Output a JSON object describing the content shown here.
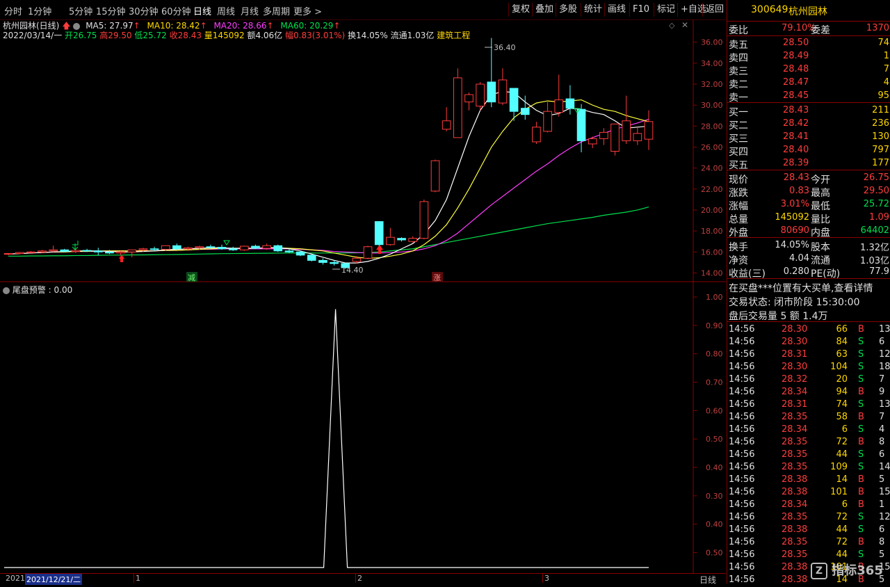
{
  "toolbar": {
    "periods": [
      "分时",
      "1分钟",
      "5分钟",
      "15分钟",
      "30分钟",
      "60分钟",
      "日线",
      "周线",
      "月线",
      "多周期",
      "更多 >"
    ],
    "active_period": "日线",
    "buttons": [
      "复权",
      "叠加",
      "多股",
      "统计",
      "画线",
      "F10",
      "标记",
      "+自选",
      "返回"
    ]
  },
  "chart_header": {
    "stock_title": "杭州园林(日线)",
    "ma5": "MA5: 27.97",
    "ma10": "MA10: 28.42",
    "ma20": "MA20: 28.66",
    "ma60": "MA60: 20.29",
    "date": "2022/03/14/一",
    "open": "开26.75",
    "high": "高29.50",
    "low": "低25.72",
    "close": "收28.43",
    "volume": "量145092",
    "amount": "额4.06亿",
    "change": "幅0.83(3.01%)",
    "turnover": "换14.05%",
    "float_cap": "流通1.03亿",
    "sector": "建筑工程"
  },
  "price_axis": [
    "36.00",
    "34.00",
    "32.00",
    "30.00",
    "28.00",
    "26.00",
    "24.00",
    "22.00",
    "20.00",
    "18.00",
    "16.00",
    "14.00"
  ],
  "annotations": {
    "high_label": "36.40",
    "low_label": "14.40",
    "sign_decrease": "减",
    "sign_increase": "涨"
  },
  "oscillator": {
    "title": "尾盘预警 : 0.00",
    "axis": [
      "1.00",
      "0.90",
      "0.80",
      "0.70",
      "0.60",
      "0.50",
      "0.40",
      "0.30",
      "0.40",
      "0.50"
    ]
  },
  "bottom_bar": {
    "year": "2021",
    "date": "2021/12/21/二",
    "marks": [
      "1",
      "2",
      "3"
    ],
    "period": "日线"
  },
  "colors": {
    "up": "#ff3c3c",
    "down": "#54ffff",
    "ma5": "#ffffff",
    "ma10": "#ffff3c",
    "ma20": "#ff3cff",
    "ma60": "#00e04e",
    "grid": "#8b0000"
  },
  "chart_data": {
    "type": "candlestick",
    "candles": [
      [
        15.8,
        15.9,
        15.7,
        15.85
      ],
      [
        15.85,
        16.0,
        15.8,
        15.95
      ],
      [
        15.95,
        16.1,
        15.9,
        16.0
      ],
      [
        16.0,
        16.2,
        15.9,
        16.1
      ],
      [
        16.1,
        16.6,
        16.0,
        16.2
      ],
      [
        16.2,
        16.3,
        16.0,
        16.05
      ],
      [
        16.05,
        16.3,
        15.9,
        16.15
      ],
      [
        16.15,
        16.3,
        16.0,
        16.1
      ],
      [
        16.1,
        16.4,
        15.7,
        16.0
      ],
      [
        16.0,
        16.2,
        15.8,
        15.9
      ],
      [
        15.9,
        16.1,
        15.7,
        16.0
      ],
      [
        16.0,
        16.2,
        15.5,
        16.2
      ],
      [
        16.2,
        16.4,
        16.0,
        16.3
      ],
      [
        16.3,
        16.5,
        16.1,
        16.25
      ],
      [
        16.25,
        16.6,
        16.1,
        16.6
      ],
      [
        16.6,
        16.8,
        16.2,
        16.3
      ],
      [
        16.3,
        16.5,
        16.1,
        16.4
      ],
      [
        16.4,
        16.6,
        16.2,
        16.5
      ],
      [
        16.5,
        16.7,
        16.3,
        16.45
      ],
      [
        16.45,
        16.7,
        16.2,
        16.3
      ],
      [
        16.3,
        16.5,
        16.1,
        16.2
      ],
      [
        16.2,
        16.6,
        16.1,
        16.55
      ],
      [
        16.55,
        16.7,
        16.3,
        16.35
      ],
      [
        16.35,
        16.8,
        16.2,
        16.6
      ],
      [
        16.6,
        16.7,
        16.0,
        16.1
      ],
      [
        16.1,
        16.3,
        15.9,
        16.0
      ],
      [
        16.0,
        16.1,
        15.6,
        15.7
      ],
      [
        15.7,
        15.8,
        15.1,
        15.2
      ],
      [
        15.2,
        15.4,
        14.8,
        15.0
      ],
      [
        15.0,
        15.2,
        14.7,
        14.9
      ],
      [
        14.9,
        15.0,
        14.4,
        14.5
      ],
      [
        15.1,
        15.6,
        14.9,
        15.4
      ],
      [
        15.4,
        16.6,
        15.3,
        16.5
      ],
      [
        18.9,
        18.9,
        16.5,
        16.7
      ],
      [
        16.7,
        18.3,
        16.6,
        17.4
      ],
      [
        17.3,
        17.4,
        17.0,
        17.15
      ],
      [
        17.0,
        17.5,
        16.9,
        17.3
      ],
      [
        17.3,
        21.0,
        17.2,
        20.8
      ],
      [
        21.8,
        24.8,
        21.7,
        24.7
      ],
      [
        27.7,
        29.8,
        27.5,
        28.5
      ],
      [
        26.9,
        33.5,
        26.9,
        32.6
      ],
      [
        30.3,
        31.2,
        29.5,
        31.0
      ],
      [
        29.9,
        32.2,
        29.5,
        32.0
      ],
      [
        32.2,
        36.4,
        29.8,
        30.3
      ],
      [
        30.2,
        33.5,
        30.0,
        32.4
      ],
      [
        31.6,
        31.6,
        28.5,
        29.4
      ],
      [
        29.7,
        30.9,
        28.6,
        29.1
      ],
      [
        26.5,
        28.4,
        26.3,
        27.9
      ],
      [
        27.5,
        30.3,
        27.4,
        29.4
      ],
      [
        29.3,
        32.9,
        28.9,
        30.5
      ],
      [
        30.6,
        31.9,
        29.1,
        29.7
      ],
      [
        29.6,
        30.1,
        25.5,
        26.6
      ],
      [
        26.3,
        27.0,
        25.9,
        26.8
      ],
      [
        26.8,
        27.8,
        26.2,
        27.4
      ],
      [
        25.6,
        27.9,
        25.2,
        28.2
      ],
      [
        26.6,
        30.9,
        26.3,
        28.5
      ],
      [
        26.6,
        28.0,
        26.2,
        27.3
      ],
      [
        26.75,
        29.5,
        25.72,
        28.43
      ]
    ],
    "ma5": [
      15.8,
      15.85,
      15.9,
      15.95,
      16.0,
      16.05,
      16.1,
      16.1,
      16.1,
      16.05,
      16.0,
      16.0,
      16.05,
      16.1,
      16.2,
      16.25,
      16.3,
      16.35,
      16.4,
      16.4,
      16.35,
      16.35,
      16.35,
      16.4,
      16.4,
      16.3,
      16.1,
      15.8,
      15.5,
      15.2,
      14.95,
      14.95,
      15.1,
      15.4,
      15.8,
      16.3,
      16.8,
      17.7,
      19.0,
      21.0,
      24.0,
      27.0,
      29.5,
      31.0,
      31.3,
      31.2,
      30.3,
      29.5,
      29.0,
      29.2,
      29.7,
      29.6,
      29.3,
      29.1,
      28.5,
      27.8,
      27.9,
      28.0
    ],
    "ma10": [
      15.8,
      15.85,
      15.9,
      15.95,
      16.0,
      16.0,
      16.05,
      16.05,
      16.1,
      16.1,
      16.1,
      16.1,
      16.1,
      16.1,
      16.15,
      16.15,
      16.2,
      16.25,
      16.3,
      16.35,
      16.35,
      16.35,
      16.35,
      16.4,
      16.4,
      16.35,
      16.3,
      16.2,
      16.1,
      15.9,
      15.7,
      15.5,
      15.4,
      15.45,
      15.6,
      15.8,
      16.1,
      16.7,
      17.5,
      18.6,
      20.2,
      22.0,
      24.0,
      26.0,
      27.5,
      28.8,
      29.6,
      30.2,
      30.4,
      30.3,
      30.4,
      30.5,
      30.0,
      29.6,
      29.4,
      29.0,
      28.7,
      28.42
    ],
    "ma20": [
      15.8,
      15.85,
      15.9,
      15.95,
      16.0,
      16.0,
      16.05,
      16.05,
      16.05,
      16.1,
      16.1,
      16.1,
      16.1,
      16.1,
      16.15,
      16.15,
      16.2,
      16.25,
      16.25,
      16.3,
      16.3,
      16.3,
      16.3,
      16.3,
      16.3,
      16.3,
      16.25,
      16.2,
      16.15,
      16.05,
      16.0,
      15.95,
      15.9,
      15.9,
      15.95,
      16.0,
      16.1,
      16.3,
      16.6,
      17.1,
      17.8,
      18.7,
      19.6,
      20.5,
      21.3,
      22.1,
      22.9,
      23.7,
      24.4,
      25.2,
      25.9,
      26.5,
      26.9,
      27.3,
      27.7,
      28.0,
      28.3,
      28.66
    ],
    "ma60": [
      15.6,
      15.6,
      15.62,
      15.62,
      15.64,
      15.64,
      15.66,
      15.66,
      15.68,
      15.7,
      15.7,
      15.72,
      15.72,
      15.74,
      15.75,
      15.76,
      15.78,
      15.8,
      15.82,
      15.84,
      15.85,
      15.86,
      15.87,
      15.88,
      15.89,
      15.9,
      15.9,
      15.9,
      15.9,
      15.9,
      15.9,
      15.92,
      15.95,
      16.0,
      16.1,
      16.2,
      16.3,
      16.5,
      16.7,
      16.9,
      17.1,
      17.3,
      17.5,
      17.7,
      17.9,
      18.1,
      18.3,
      18.5,
      18.7,
      18.85,
      19.0,
      19.15,
      19.3,
      19.5,
      19.65,
      19.8,
      20.0,
      20.29
    ],
    "oscillator_values": "0 everywhere except a single spike to 1.00",
    "ylim_main": [
      13.5,
      37.5
    ],
    "ylim_osc": [
      0,
      1.05
    ]
  },
  "panel": {
    "header": {
      "code": "300649",
      "name": "杭州园林"
    },
    "weibi": {
      "label": "委比",
      "value": "79.10%",
      "label2": "委差",
      "value2": "1370"
    },
    "sells": [
      {
        "label": "卖五",
        "price": "28.50",
        "vol": "74"
      },
      {
        "label": "卖四",
        "price": "28.49",
        "vol": "1"
      },
      {
        "label": "卖三",
        "price": "28.48",
        "vol": "7"
      },
      {
        "label": "卖二",
        "price": "28.47",
        "vol": "4"
      },
      {
        "label": "卖一",
        "price": "28.45",
        "vol": "95"
      }
    ],
    "buys": [
      {
        "label": "买一",
        "price": "28.43",
        "vol": "211"
      },
      {
        "label": "买二",
        "price": "28.42",
        "vol": "236"
      },
      {
        "label": "买三",
        "price": "28.41",
        "vol": "130"
      },
      {
        "label": "买四",
        "price": "28.40",
        "vol": "797"
      },
      {
        "label": "买五",
        "price": "28.39",
        "vol": "177"
      }
    ],
    "stats": [
      {
        "l1": "现价",
        "v1": "28.43",
        "l2": "今开",
        "v2": "26.75"
      },
      {
        "l1": "涨跌",
        "v1": "0.83",
        "l2": "最高",
        "v2": "29.50"
      },
      {
        "l1": "涨幅",
        "v1": "3.01%",
        "l2": "最低",
        "v2": "25.72"
      },
      {
        "l1": "总量",
        "v1": "145092",
        "l2": "量比",
        "v2": "1.09"
      },
      {
        "l1": "外盘",
        "v1": "80690",
        "l2": "内盘",
        "v2": "64402"
      }
    ],
    "stats2": [
      {
        "l1": "换手",
        "v1": "14.05%",
        "l2": "股本",
        "v2": "1.32亿"
      },
      {
        "l1": "净资",
        "v1": "4.04",
        "l2": "流通",
        "v2": "1.03亿"
      },
      {
        "l1": "收益(三)",
        "v1": "0.280",
        "l2": "PE(动)",
        "v2": "77.9"
      }
    ],
    "notice": "在买盘***位置有大买单,查看详情",
    "trade_status": "交易状态: 闭市阶段 15:30:00",
    "after_hours": "盘后交易量 5 额 1.4万",
    "ticks": [
      {
        "t": "14:56",
        "p": "28.30",
        "v": "66",
        "d": "B",
        "n": "13"
      },
      {
        "t": "14:56",
        "p": "28.30",
        "v": "84",
        "d": "S",
        "n": "6"
      },
      {
        "t": "14:56",
        "p": "28.31",
        "v": "63",
        "d": "S",
        "n": "12"
      },
      {
        "t": "14:56",
        "p": "28.30",
        "v": "104",
        "d": "S",
        "n": "18"
      },
      {
        "t": "14:56",
        "p": "28.32",
        "v": "20",
        "d": "S",
        "n": "7"
      },
      {
        "t": "14:56",
        "p": "28.34",
        "v": "94",
        "d": "B",
        "n": "9"
      },
      {
        "t": "14:56",
        "p": "28.31",
        "v": "74",
        "d": "S",
        "n": "13"
      },
      {
        "t": "14:56",
        "p": "28.35",
        "v": "58",
        "d": "B",
        "n": "7"
      },
      {
        "t": "14:56",
        "p": "28.34",
        "v": "6",
        "d": "S",
        "n": "4"
      },
      {
        "t": "14:56",
        "p": "28.35",
        "v": "72",
        "d": "B",
        "n": "8"
      },
      {
        "t": "14:56",
        "p": "28.35",
        "v": "44",
        "d": "S",
        "n": "6"
      },
      {
        "t": "14:56",
        "p": "28.35",
        "v": "109",
        "d": "S",
        "n": "14"
      },
      {
        "t": "14:56",
        "p": "28.38",
        "v": "14",
        "d": "B",
        "n": "5"
      },
      {
        "t": "14:56",
        "p": "28.38",
        "v": "101",
        "d": "B",
        "n": "15"
      },
      {
        "t": "14:56",
        "p": "28.34",
        "v": "6",
        "d": "B",
        "n": "1"
      },
      {
        "t": "14:56",
        "p": "28.35",
        "v": "72",
        "d": "S",
        "n": "12"
      },
      {
        "t": "14:56",
        "p": "28.38",
        "v": "44",
        "d": "S",
        "n": "6"
      },
      {
        "t": "14:56",
        "p": "28.35",
        "v": "72",
        "d": "B",
        "n": "8"
      },
      {
        "t": "14:56",
        "p": "28.35",
        "v": "44",
        "d": "S",
        "n": "5"
      },
      {
        "t": "14:56",
        "p": "28.38",
        "v": "101",
        "d": "B",
        "n": "15"
      },
      {
        "t": "14:56",
        "p": "28.38",
        "v": "14",
        "d": "B",
        "n": "5"
      }
    ]
  },
  "watermark": "指标365"
}
